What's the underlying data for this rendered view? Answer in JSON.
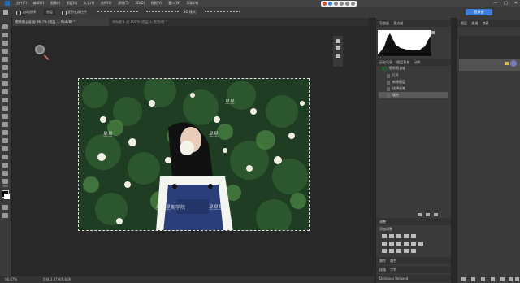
{
  "menubar": {
    "app_icon": "ps-logo-icon",
    "items": [
      "文件(F)",
      "编辑(E)",
      "图像(I)",
      "图层(L)",
      "文字(Y)",
      "选择(S)",
      "滤镜(T)",
      "3D(D)",
      "视图(V)",
      "窗口(W)",
      "帮助(H)"
    ],
    "window_controls": [
      "—",
      "□",
      "✕"
    ]
  },
  "options": {
    "auto_select": "自动选择：",
    "layer_select": "图层",
    "show_transform": "显示变换控件",
    "mode_3d": "3D 模式：",
    "login_button": "登录云"
  },
  "document_tab": {
    "label": "壁纸图.jpg @ 66.7% (图层 1, RGB/8) *"
  },
  "second_tab": {
    "label": "未标题-1 @ 100% (图层 1, 灰色/8) *"
  },
  "panels": {
    "top_tabs": [
      "导航器",
      "直方图"
    ],
    "history_tabs": [
      "历史记录",
      "图层复合",
      "动作"
    ],
    "history_items": [
      "壁纸图.jpg",
      "打开",
      "新建图层",
      "选择画笔",
      "填充"
    ],
    "adjust_tabs": [
      "调整"
    ],
    "adjust_title": "添加调整",
    "bottom_tabs": [
      "属性",
      "颜色"
    ],
    "bottom_tabs_2": [
      "段落",
      "字符"
    ],
    "status_small": "Delicious Relaxed",
    "layer_tabs": [
      "图层",
      "通道",
      "路径"
    ]
  },
  "watermarks": {
    "text_a": "星星",
    "text_b": "星星星期学院",
    "text_c": "星星星期"
  },
  "status": {
    "zoom": "66.67%",
    "doc_info": "文档:3.37M/6.86M"
  },
  "colors": {
    "accent": "#3b7dd8",
    "selected_row": "#5a5a5a",
    "panel_bg": "#3a3a3a",
    "canvas_bg": "#282828"
  }
}
